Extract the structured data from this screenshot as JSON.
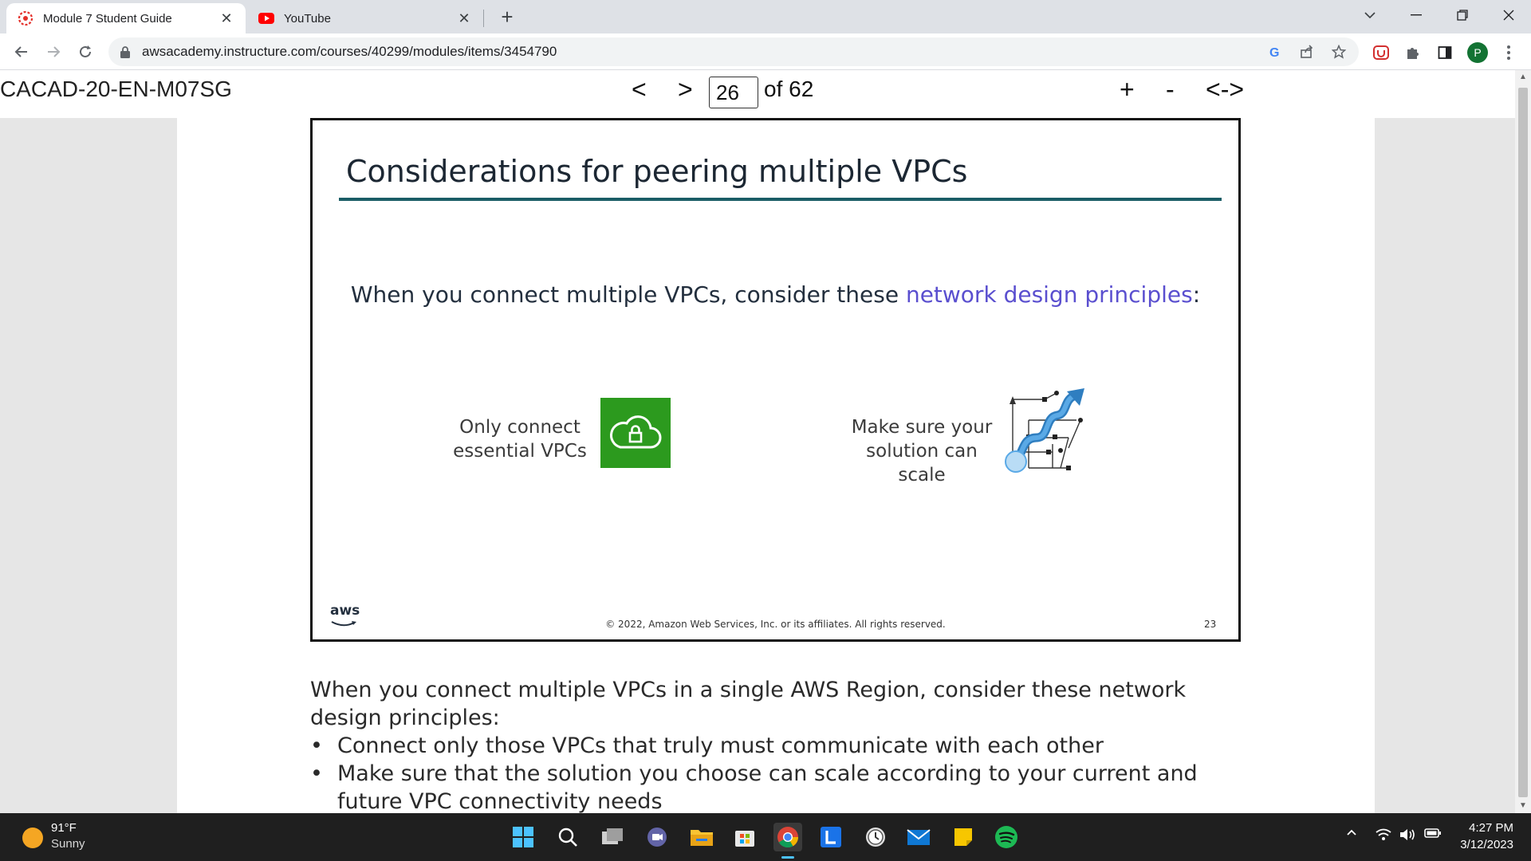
{
  "browser": {
    "tabs": [
      {
        "title": "Module 7 Student Guide",
        "active": true,
        "icon": "canvas-icon"
      },
      {
        "title": "YouTube",
        "active": false,
        "icon": "youtube-icon"
      }
    ],
    "close_glyph": "✕",
    "new_tab_glyph": "+",
    "url": "awsacademy.instructure.com/courses/40299/modules/items/3454790",
    "profile_initial": "P"
  },
  "viewer": {
    "doc_title": "CACAD-20-EN-M07SG",
    "prev_label": "<",
    "next_label": ">",
    "page_current": "26",
    "page_of": "of 62",
    "zoom_in_label": "+",
    "zoom_out_label": "-",
    "fit_label": "<->"
  },
  "slide": {
    "title": "Considerations for peering multiple VPCs",
    "lead_before": "When you connect multiple VPCs, consider these ",
    "lead_highlight": "network design principles",
    "lead_after": ":",
    "principle_1_line1": "Only connect",
    "principle_1_line2": "essential VPCs",
    "principle_2_line1": "Make sure your",
    "principle_2_line2": "solution can scale",
    "aws_logo": "aws",
    "copyright": "© 2022, Amazon Web Services, Inc. or its affiliates. All rights reserved.",
    "slide_number": "23",
    "highlight_color": "#5a4fcf",
    "accent_rule_color": "#1a5d66",
    "cloud_box_color": "#2c9a1e"
  },
  "notes": {
    "paragraph": "When you connect multiple VPCs in a single AWS Region, consider these network design principles:",
    "bullets": [
      "Connect only those VPCs that truly must communicate with each other",
      "Make sure that the solution you choose can scale according to your current and future VPC connectivity needs"
    ]
  },
  "taskbar": {
    "weather_temp": "91°F",
    "weather_condition": "Sunny",
    "apps": [
      "windows-start-icon",
      "search-icon",
      "task-view-icon",
      "teams-chat-icon",
      "file-explorer-icon",
      "microsoft-store-icon",
      "chrome-icon",
      "l-app-icon",
      "clock-app-icon",
      "mail-icon",
      "sticky-notes-icon",
      "spotify-icon"
    ],
    "time": "4:27 PM",
    "date": "3/12/2023"
  }
}
